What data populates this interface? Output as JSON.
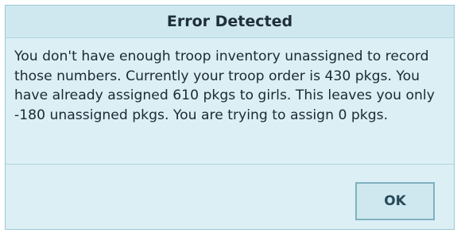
{
  "dialog": {
    "title": "Error Detected",
    "message": "You don't have enough troop inventory unassigned to record those numbers. Currently your troop order is 430 pkgs. You have already assigned 610 pkgs to girls. This leaves you only -180 unassigned pkgs. You are trying to assign 0 pkgs.",
    "ok_label": "OK"
  },
  "colors": {
    "dialog_background": "#dbeff5",
    "title_background": "#cfe8ef",
    "border": "#9dc7d3",
    "button_border": "#7fb0bf",
    "text": "#1c2a33"
  }
}
